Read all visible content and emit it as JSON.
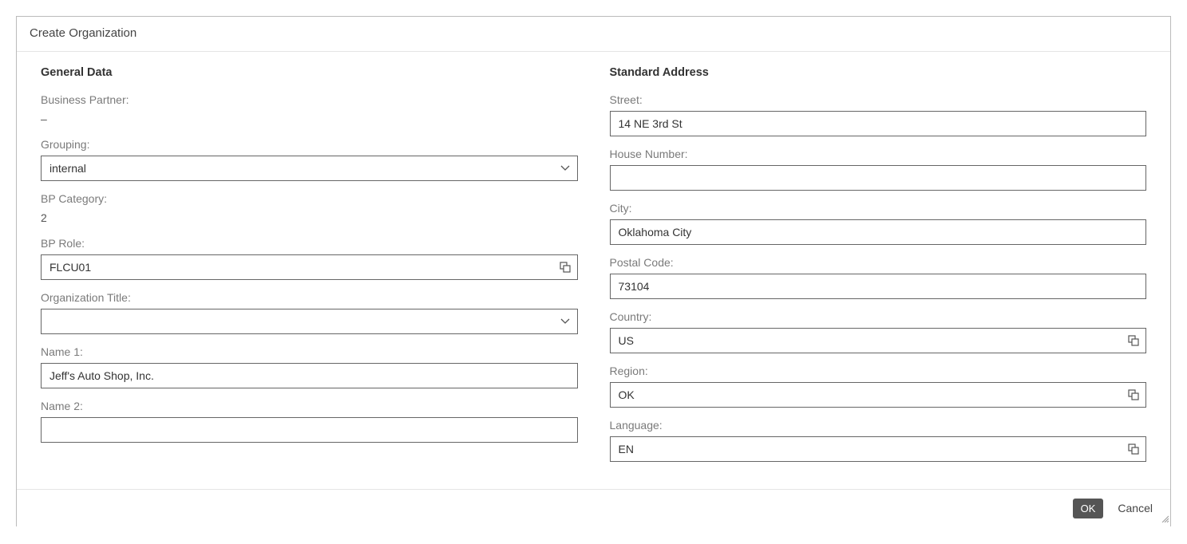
{
  "dialog": {
    "title": "Create Organization"
  },
  "general": {
    "heading": "General Data",
    "business_partner_label": "Business Partner:",
    "business_partner_value": "–",
    "grouping_label": "Grouping:",
    "grouping_value": "internal",
    "bp_category_label": "BP Category:",
    "bp_category_value": "2",
    "bp_role_label": "BP Role:",
    "bp_role_value": "FLCU01",
    "org_title_label": "Organization Title:",
    "org_title_value": "",
    "name1_label": "Name 1:",
    "name1_value": "Jeff's Auto Shop, Inc.",
    "name2_label": "Name 2:",
    "name2_value": ""
  },
  "address": {
    "heading": "Standard Address",
    "street_label": "Street:",
    "street_value": "14 NE 3rd St",
    "house_no_label": "House Number:",
    "house_no_value": "",
    "city_label": "City:",
    "city_value": "Oklahoma City",
    "postal_label": "Postal Code:",
    "postal_value": "73104",
    "country_label": "Country:",
    "country_value": "US",
    "region_label": "Region:",
    "region_value": "OK",
    "language_label": "Language:",
    "language_value": "EN"
  },
  "footer": {
    "ok": "OK",
    "cancel": "Cancel"
  }
}
